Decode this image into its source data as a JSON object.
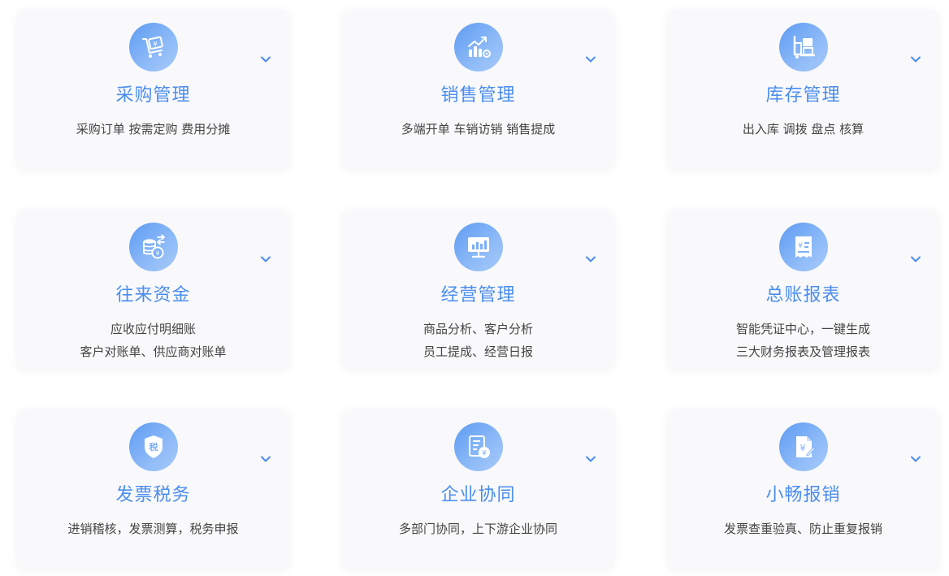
{
  "colors": {
    "accent": "#4a8df0",
    "icon_gradient_start": "#5d9bf3",
    "icon_gradient_end": "#a9cbf9",
    "card_bg": "#f9f9fb",
    "text": "#444444"
  },
  "cards": [
    {
      "title": "采购管理",
      "lines": [
        "采购订单 按需定购 费用分摊"
      ],
      "icon": "purchase-cart-icon"
    },
    {
      "title": "销售管理",
      "lines": [
        "多端开单 车销访销 销售提成"
      ],
      "icon": "sales-chart-icon"
    },
    {
      "title": "库存管理",
      "lines": [
        "出入库 调拨 盘点 核算"
      ],
      "icon": "inventory-forklift-icon"
    },
    {
      "title": "往来资金",
      "lines": [
        "应收应付明细账",
        "客户对账单、供应商对账单"
      ],
      "icon": "coins-exchange-icon"
    },
    {
      "title": "经营管理",
      "lines": [
        "商品分析、客户分析",
        "员工提成、经营日报"
      ],
      "icon": "monitor-chart-icon"
    },
    {
      "title": "总账报表",
      "lines": [
        "智能凭证中心，一键生成",
        "三大财务报表及管理报表"
      ],
      "icon": "ledger-receipt-icon"
    },
    {
      "title": "发票税务",
      "lines": [
        "进销稽核，发票测算，税务申报"
      ],
      "icon": "tax-shield-icon",
      "icon_text": "税"
    },
    {
      "title": "企业协同",
      "lines": [
        "多部门协同，上下游企业协同"
      ],
      "icon": "document-coin-icon"
    },
    {
      "title": "小畅报销",
      "lines": [
        "发票查重验真、防止重复报销"
      ],
      "icon": "reimburse-document-icon"
    }
  ]
}
